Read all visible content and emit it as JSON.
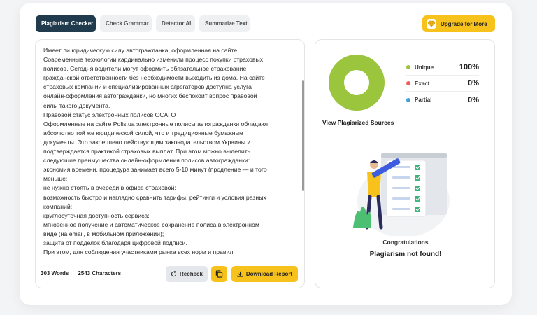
{
  "tabs": [
    {
      "label": "Plagiarism Checker",
      "active": true
    },
    {
      "label": "Check Grammar",
      "active": false
    },
    {
      "label": "Detector AI",
      "active": false
    },
    {
      "label": "Summarize Text",
      "active": false
    }
  ],
  "upgrade": {
    "label": "Upgrade for More",
    "icon": "diamond-icon"
  },
  "editor": {
    "lines": [
      "Имеет ли юридическую силу автогражданка, оформленная на сайте",
      "Современные технологии кардинально изменили процесс покупки страховых",
      "полисов. Сегодня водители могут оформить обязательное страхование",
      "гражданской ответственности без необходимости выходить из дома. На сайте",
      "страховых компаний и специализированных агрегаторов доступна услуга",
      "онлайн-оформления автогражданки, но многих беспокоит вопрос правовой",
      "силы такого документа.",
      "Правовой статус электронных полисов ОСАГО",
      "Оформленные на сайте Polis.ua электронные полисы автогражданки обладают",
      "абсолютно той же юридической силой, что и традиционные бумажные",
      "документы. Это закреплено действующим законодательством Украины и",
      "подтверждается практикой страховых выплат. При этом можно выделить",
      "следующие преимущества онлайн-оформления полисов автогражданки:",
      "экономия времени, процедура занимает всего 5-10 минут (продление — и того",
      "меньше;",
      "не нужно стоять в очереди в офисе страховой;",
      "возможность быстро и наглядно сравнить тарифы, рейтинги и условия разных",
      "компаний;",
      "круглосуточная доступность сервиса;",
      "мгновенное получение и автоматическое сохранение полиса в электронном",
      "виде (на email, в мобильном приложении);",
      "защита от подделок благодаря цифровой подписи.",
      "При этом, для соблюдения участниками рынка всех норм и правил"
    ],
    "words": "303 Words",
    "characters": "2543 Characters"
  },
  "actions": {
    "recheck": "Recheck",
    "download": "Download Report"
  },
  "result": {
    "legend": [
      {
        "label": "Unique",
        "value": "100%",
        "color": "#9bc53d"
      },
      {
        "label": "Exact",
        "value": "0%",
        "color": "#f05a5a"
      },
      {
        "label": "Partial",
        "value": "0%",
        "color": "#3fa1d8"
      }
    ],
    "unique_fraction": 1.0,
    "view_sources": "View Plagiarized Sources",
    "congrats": "Congratulations",
    "status": "Plagiarism not found!"
  },
  "colors": {
    "accent": "#f7c21b",
    "active_tab": "#1f3b4d",
    "unique": "#9bc53d"
  }
}
